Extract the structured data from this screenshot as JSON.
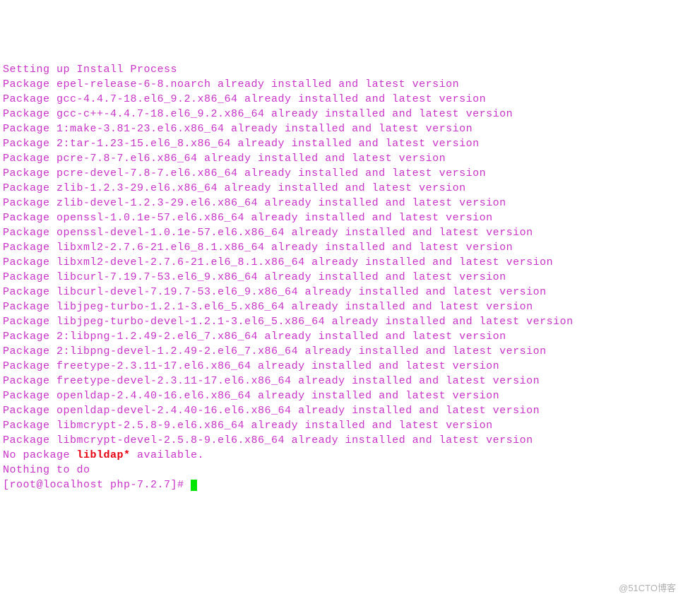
{
  "lines": [
    "Setting up Install Process",
    "Package epel-release-6-8.noarch already installed and latest version",
    "Package gcc-4.4.7-18.el6_9.2.x86_64 already installed and latest version",
    "Package gcc-c++-4.4.7-18.el6_9.2.x86_64 already installed and latest version",
    "Package 1:make-3.81-23.el6.x86_64 already installed and latest version",
    "Package 2:tar-1.23-15.el6_8.x86_64 already installed and latest version",
    "Package pcre-7.8-7.el6.x86_64 already installed and latest version",
    "Package pcre-devel-7.8-7.el6.x86_64 already installed and latest version",
    "Package zlib-1.2.3-29.el6.x86_64 already installed and latest version",
    "Package zlib-devel-1.2.3-29.el6.x86_64 already installed and latest version",
    "Package openssl-1.0.1e-57.el6.x86_64 already installed and latest version",
    "Package openssl-devel-1.0.1e-57.el6.x86_64 already installed and latest version",
    "Package libxml2-2.7.6-21.el6_8.1.x86_64 already installed and latest version",
    "Package libxml2-devel-2.7.6-21.el6_8.1.x86_64 already installed and latest version",
    "Package libcurl-7.19.7-53.el6_9.x86_64 already installed and latest version",
    "Package libcurl-devel-7.19.7-53.el6_9.x86_64 already installed and latest version",
    "Package libjpeg-turbo-1.2.1-3.el6_5.x86_64 already installed and latest version",
    "Package libjpeg-turbo-devel-1.2.1-3.el6_5.x86_64 already installed and latest version",
    "Package 2:libpng-1.2.49-2.el6_7.x86_64 already installed and latest version",
    "Package 2:libpng-devel-1.2.49-2.el6_7.x86_64 already installed and latest version",
    "Package freetype-2.3.11-17.el6.x86_64 already installed and latest version",
    "Package freetype-devel-2.3.11-17.el6.x86_64 already installed and latest version",
    "Package openldap-2.4.40-16.el6.x86_64 already installed and latest version",
    "Package openldap-devel-2.4.40-16.el6.x86_64 already installed and latest version",
    "Package libmcrypt-2.5.8-9.el6.x86_64 already installed and latest version",
    "Package libmcrypt-devel-2.5.8-9.el6.x86_64 already installed and latest version"
  ],
  "no_package_prefix": "No package ",
  "no_package_name": "libldap*",
  "no_package_suffix": " available.",
  "nothing_to_do": "Nothing to do",
  "prompt": "[root@localhost php-7.2.7]# ",
  "watermark": "@51CTO博客"
}
